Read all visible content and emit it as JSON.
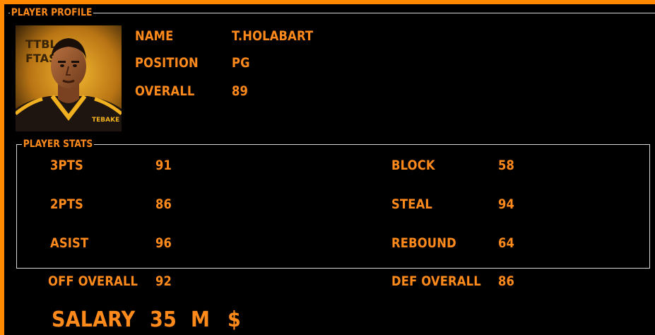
{
  "profile": {
    "section_title": "PLAYER PROFILE",
    "name_label": "NAME",
    "name_value": "T.HOLABART",
    "position_label": "POSITION",
    "position_value": "PG",
    "overall_label": "OVERALL",
    "overall_value": "89",
    "avatar_poster_text": "TTBL FTASN",
    "jersey_text": "TEBAKE"
  },
  "stats": {
    "section_title": "PLAYER STATS",
    "three_pts_label": "3PTS",
    "three_pts_value": "91",
    "two_pts_label": "2PTS",
    "two_pts_value": "86",
    "assist_label": "ASIST",
    "assist_value": "96",
    "block_label": "BLOCK",
    "block_value": "58",
    "steal_label": "STEAL",
    "steal_value": "94",
    "rebound_label": "REBOUND",
    "rebound_value": "64"
  },
  "overall_ratings": {
    "off_label": "OFF OVERALL",
    "off_value": "92",
    "def_label": "DEF OVERALL",
    "def_value": "86"
  },
  "salary": {
    "label": "SALARY",
    "amount": "35",
    "unit": "M",
    "currency": "$"
  },
  "colors": {
    "accent": "#ff8a1c",
    "frame": "#ff8a00",
    "background": "#000000",
    "border": "#d8d8d8"
  }
}
